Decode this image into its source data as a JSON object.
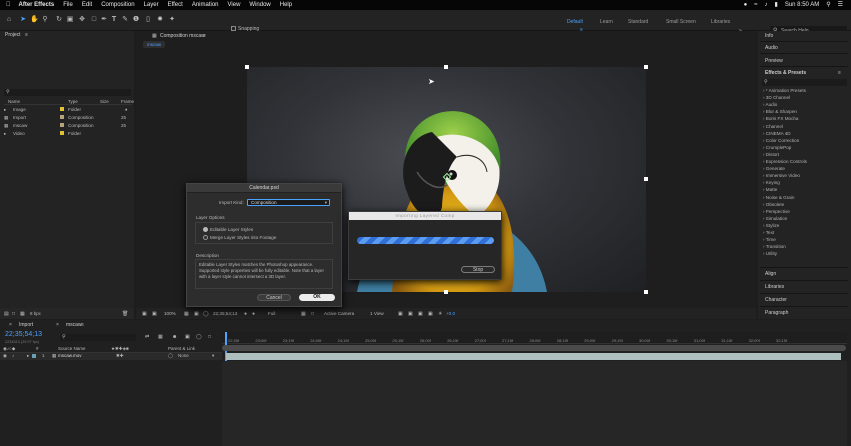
{
  "menubar": {
    "app": "After Effects",
    "items": [
      "File",
      "Edit",
      "Composition",
      "Layer",
      "Effect",
      "Animation",
      "View",
      "Window",
      "Help"
    ],
    "clock": "Sun 8:50 AM"
  },
  "toolbar": {
    "snapping_label": "Snapping",
    "workspaces": [
      "Default",
      "Learn",
      "Standard",
      "Small Screen",
      "Libraries"
    ],
    "active_workspace": "Default",
    "search_placeholder": "Search Help"
  },
  "project": {
    "tab": "Project",
    "search_placeholder": "",
    "columns": [
      "Name",
      "Type",
      "Size",
      "Frame"
    ],
    "rows": [
      {
        "name": "Image",
        "type": "Folder",
        "frame": "",
        "color": "#e0c13a"
      },
      {
        "name": "Import",
        "type": "Composition",
        "frame": "25",
        "color": "#b7a37a"
      },
      {
        "name": "mscaw",
        "type": "Composition",
        "frame": "25",
        "color": "#b7a37a"
      },
      {
        "name": "Video",
        "type": "Folder",
        "frame": "",
        "color": "#e0c13a"
      }
    ],
    "bpc": "8 bpc"
  },
  "composition": {
    "tab": "Composition mscaw",
    "subtab": "mscaw",
    "zoom": "100%",
    "timecode": "22;35;54;13",
    "resolution": "Full",
    "camera": "Active Camera",
    "views": "1 View",
    "exposure": "+0.0"
  },
  "dialog": {
    "title": "Calendar.psd",
    "import_kind_label": "Import Kind:",
    "import_kind_value": "Composition",
    "layer_options_label": "Layer Options",
    "option1": "Editable Layer Styles",
    "option2": "Merge Layer Styles into Footage",
    "description_label": "Description",
    "description_text": "Editable Layer Styles matches the Photoshop appearance. Supported style properties will be fully editable. Note that a layer with a layer style cannot intersect a 3D layer.",
    "cancel": "Cancel",
    "ok": "OK"
  },
  "progress": {
    "title": "Importing Layered Comp",
    "stop": "Stop"
  },
  "right_panels": {
    "top": [
      "Info",
      "Audio",
      "Preview"
    ],
    "effects_title": "Effects & Presets",
    "effects": [
      "* Animation Presets",
      "3D Channel",
      "Audio",
      "Blur & Sharpen",
      "Boris FX Mocha",
      "Channel",
      "CINEMA 4D",
      "Color Correction",
      "CrumplePop",
      "Distort",
      "Expression Controls",
      "Generate",
      "Immersive Video",
      "Keying",
      "Matte",
      "Noise & Grain",
      "Obsolete",
      "Perspective",
      "Simulation",
      "Stylize",
      "Text",
      "Time",
      "Transition",
      "Utility"
    ],
    "bottom": [
      "Align",
      "Libraries",
      "Character",
      "Paragraph"
    ]
  },
  "timeline": {
    "tabs": [
      "Import",
      "mscaw"
    ],
    "timecode": "22;35;54;13",
    "sub_timecode": "2234513 (29.97 fps)",
    "columns": {
      "source": "Source Name",
      "parent": "Parent & Link"
    },
    "layer": {
      "num": "1",
      "name": "mscaw.mov",
      "parent": "None"
    },
    "ticks": [
      "22;35f",
      "23;00f",
      "23;15f",
      "24;00f",
      "24;15f",
      "25;00f",
      "25;15f",
      "26;00f",
      "26;15f",
      "27;00f",
      "27;15f",
      "28;00f",
      "28;15f",
      "29;00f",
      "29;15f",
      "30;00f",
      "30;15f",
      "31;00f",
      "31;15f",
      "32;00f",
      "32;15f"
    ]
  },
  "colors": {
    "accent": "#2d8ceb",
    "bar": "#aebfc0",
    "progress": "#3b7ddf"
  }
}
